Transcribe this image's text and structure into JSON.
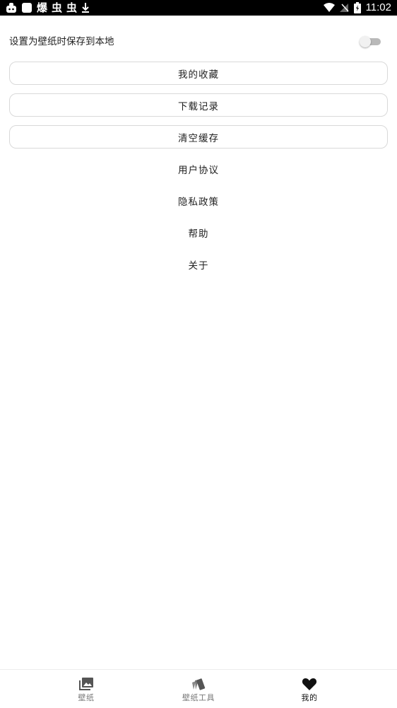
{
  "status_bar": {
    "time": "11:02",
    "left_icons": [
      "bug-icon",
      "app-icon",
      "app-icon-2",
      "app-icon-3",
      "app-icon-4",
      "download-icon"
    ],
    "right_icons": [
      "wifi-icon",
      "signal-off-icon",
      "battery-charging-icon"
    ]
  },
  "settings": {
    "save_local_label": "设置为壁纸时保存到本地",
    "save_local_enabled": false
  },
  "menu": {
    "favorites": "我的收藏",
    "downloads": "下载记录",
    "clear_cache": "清空缓存",
    "user_agreement": "用户协议",
    "privacy_policy": "隐私政策",
    "help": "帮助",
    "about": "关于"
  },
  "bottom_nav": {
    "items": [
      {
        "label": "壁纸",
        "icon": "images-icon",
        "active": false
      },
      {
        "label": "壁纸工具",
        "icon": "swatches-icon",
        "active": false
      },
      {
        "label": "我的",
        "icon": "heart-icon",
        "active": true
      }
    ]
  },
  "colors": {
    "status_bar_bg": "#000000",
    "background": "#ffffff",
    "text": "#222222",
    "border": "#d9d9d9",
    "nav_inactive": "#777777",
    "nav_active": "#111111"
  }
}
